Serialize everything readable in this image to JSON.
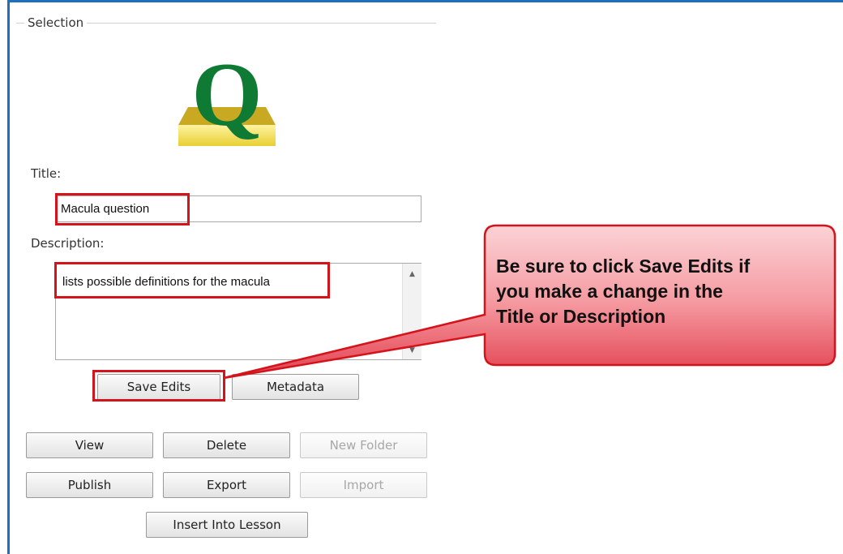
{
  "selection": {
    "group_label": "Selection",
    "icon_name": "question-icon",
    "icon_letter": "Q",
    "colors": {
      "icon_letter": "#0e7a34",
      "icon_tray": "#f3e04f",
      "highlight": "#d4131b",
      "callout_fill": "#ef6f7a",
      "frame": "#1f6fc0"
    }
  },
  "title": {
    "label": "Title:",
    "value": "Macula question"
  },
  "description": {
    "label": "Description:",
    "value": "lists possible definitions for the macula"
  },
  "buttons": {
    "save_edits": "Save Edits",
    "metadata": "Metadata",
    "view": "View",
    "delete": "Delete",
    "new_folder": "New Folder",
    "publish": "Publish",
    "export": "Export",
    "import": "Import",
    "insert_into_lesson": "Insert Into Lesson"
  },
  "callout": {
    "line1": "Be sure to click Save Edits if",
    "line2": "you make a change in the",
    "line3": "Title or Description"
  }
}
